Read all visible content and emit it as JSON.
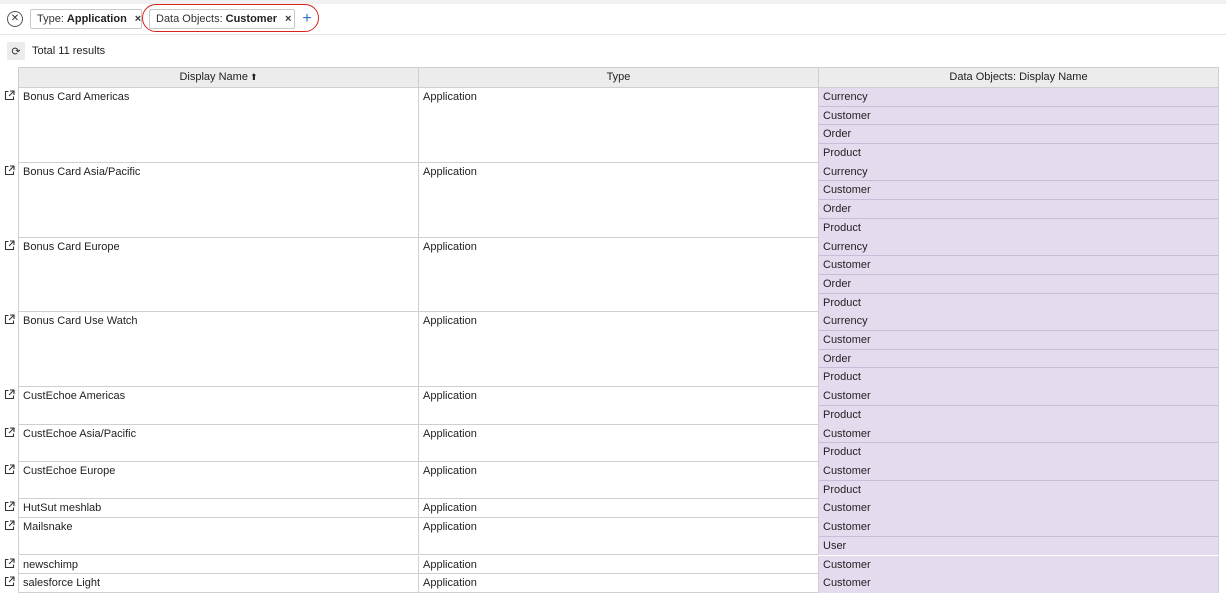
{
  "filters": {
    "clear_icon": "x-circle-icon",
    "chips": [
      {
        "key": "Type:",
        "value": "Application"
      },
      {
        "key": "Data Objects:",
        "value": "Customer"
      }
    ],
    "remove_glyph": "×",
    "add_glyph": "+"
  },
  "results": {
    "total_label": "Total 11 results"
  },
  "table": {
    "columns": [
      "Display Name",
      "Type",
      "Data Objects: Display Name"
    ],
    "sort_glyph": "⬆",
    "rows": [
      {
        "name": "Bonus Card Americas",
        "type": "Application",
        "data_objects": [
          "Currency",
          "Customer",
          "Order",
          "Product"
        ]
      },
      {
        "name": "Bonus Card Asia/Pacific",
        "type": "Application",
        "data_objects": [
          "Currency",
          "Customer",
          "Order",
          "Product"
        ]
      },
      {
        "name": "Bonus Card Europe",
        "type": "Application",
        "data_objects": [
          "Currency",
          "Customer",
          "Order",
          "Product"
        ]
      },
      {
        "name": "Bonus Card Use Watch",
        "type": "Application",
        "data_objects": [
          "Currency",
          "Customer",
          "Order",
          "Product"
        ]
      },
      {
        "name": "CustEchoe Americas",
        "type": "Application",
        "data_objects": [
          "Customer",
          "Product"
        ]
      },
      {
        "name": "CustEchoe Asia/Pacific",
        "type": "Application",
        "data_objects": [
          "Customer",
          "Product"
        ]
      },
      {
        "name": "CustEchoe Europe",
        "type": "Application",
        "data_objects": [
          "Customer",
          "Product"
        ]
      },
      {
        "name": "HutSut meshlab",
        "type": "Application",
        "data_objects": [
          "Customer"
        ]
      },
      {
        "name": "Mailsnake",
        "type": "Application",
        "data_objects": [
          "Customer",
          "User"
        ]
      },
      {
        "name": "newschimp",
        "type": "Application",
        "data_objects": [
          "Customer"
        ]
      },
      {
        "name": "salesforce Light",
        "type": "Application",
        "data_objects": [
          "Customer"
        ]
      }
    ]
  },
  "colors": {
    "highlight_ring": "#d9231f",
    "add_accent": "#2a6fd6",
    "data_object_cell": "#e5dbee"
  }
}
